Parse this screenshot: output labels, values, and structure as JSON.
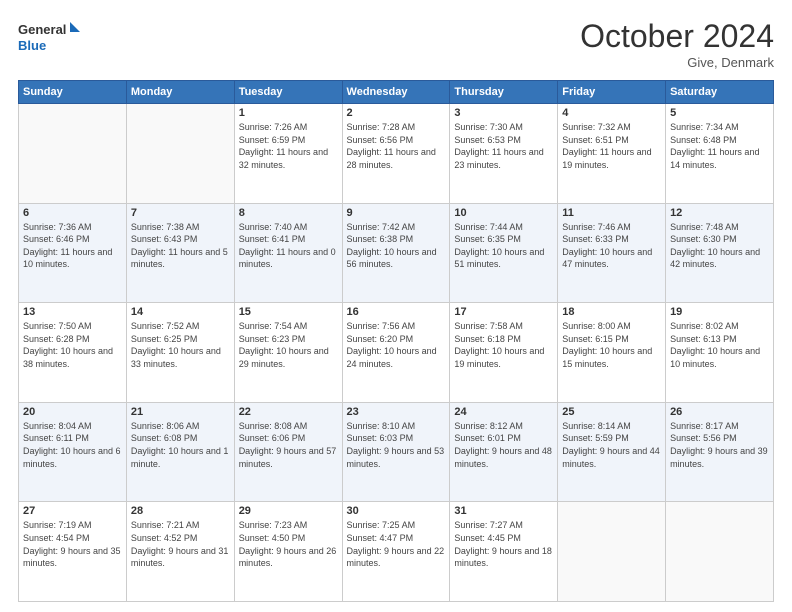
{
  "header": {
    "logo_line1": "General",
    "logo_line2": "Blue",
    "month": "October 2024",
    "location": "Give, Denmark"
  },
  "days_of_week": [
    "Sunday",
    "Monday",
    "Tuesday",
    "Wednesday",
    "Thursday",
    "Friday",
    "Saturday"
  ],
  "weeks": [
    [
      {
        "day": "",
        "detail": ""
      },
      {
        "day": "",
        "detail": ""
      },
      {
        "day": "1",
        "detail": "Sunrise: 7:26 AM\nSunset: 6:59 PM\nDaylight: 11 hours\nand 32 minutes."
      },
      {
        "day": "2",
        "detail": "Sunrise: 7:28 AM\nSunset: 6:56 PM\nDaylight: 11 hours\nand 28 minutes."
      },
      {
        "day": "3",
        "detail": "Sunrise: 7:30 AM\nSunset: 6:53 PM\nDaylight: 11 hours\nand 23 minutes."
      },
      {
        "day": "4",
        "detail": "Sunrise: 7:32 AM\nSunset: 6:51 PM\nDaylight: 11 hours\nand 19 minutes."
      },
      {
        "day": "5",
        "detail": "Sunrise: 7:34 AM\nSunset: 6:48 PM\nDaylight: 11 hours\nand 14 minutes."
      }
    ],
    [
      {
        "day": "6",
        "detail": "Sunrise: 7:36 AM\nSunset: 6:46 PM\nDaylight: 11 hours\nand 10 minutes."
      },
      {
        "day": "7",
        "detail": "Sunrise: 7:38 AM\nSunset: 6:43 PM\nDaylight: 11 hours\nand 5 minutes."
      },
      {
        "day": "8",
        "detail": "Sunrise: 7:40 AM\nSunset: 6:41 PM\nDaylight: 11 hours\nand 0 minutes."
      },
      {
        "day": "9",
        "detail": "Sunrise: 7:42 AM\nSunset: 6:38 PM\nDaylight: 10 hours\nand 56 minutes."
      },
      {
        "day": "10",
        "detail": "Sunrise: 7:44 AM\nSunset: 6:35 PM\nDaylight: 10 hours\nand 51 minutes."
      },
      {
        "day": "11",
        "detail": "Sunrise: 7:46 AM\nSunset: 6:33 PM\nDaylight: 10 hours\nand 47 minutes."
      },
      {
        "day": "12",
        "detail": "Sunrise: 7:48 AM\nSunset: 6:30 PM\nDaylight: 10 hours\nand 42 minutes."
      }
    ],
    [
      {
        "day": "13",
        "detail": "Sunrise: 7:50 AM\nSunset: 6:28 PM\nDaylight: 10 hours\nand 38 minutes."
      },
      {
        "day": "14",
        "detail": "Sunrise: 7:52 AM\nSunset: 6:25 PM\nDaylight: 10 hours\nand 33 minutes."
      },
      {
        "day": "15",
        "detail": "Sunrise: 7:54 AM\nSunset: 6:23 PM\nDaylight: 10 hours\nand 29 minutes."
      },
      {
        "day": "16",
        "detail": "Sunrise: 7:56 AM\nSunset: 6:20 PM\nDaylight: 10 hours\nand 24 minutes."
      },
      {
        "day": "17",
        "detail": "Sunrise: 7:58 AM\nSunset: 6:18 PM\nDaylight: 10 hours\nand 19 minutes."
      },
      {
        "day": "18",
        "detail": "Sunrise: 8:00 AM\nSunset: 6:15 PM\nDaylight: 10 hours\nand 15 minutes."
      },
      {
        "day": "19",
        "detail": "Sunrise: 8:02 AM\nSunset: 6:13 PM\nDaylight: 10 hours\nand 10 minutes."
      }
    ],
    [
      {
        "day": "20",
        "detail": "Sunrise: 8:04 AM\nSunset: 6:11 PM\nDaylight: 10 hours\nand 6 minutes."
      },
      {
        "day": "21",
        "detail": "Sunrise: 8:06 AM\nSunset: 6:08 PM\nDaylight: 10 hours\nand 1 minute."
      },
      {
        "day": "22",
        "detail": "Sunrise: 8:08 AM\nSunset: 6:06 PM\nDaylight: 9 hours\nand 57 minutes."
      },
      {
        "day": "23",
        "detail": "Sunrise: 8:10 AM\nSunset: 6:03 PM\nDaylight: 9 hours\nand 53 minutes."
      },
      {
        "day": "24",
        "detail": "Sunrise: 8:12 AM\nSunset: 6:01 PM\nDaylight: 9 hours\nand 48 minutes."
      },
      {
        "day": "25",
        "detail": "Sunrise: 8:14 AM\nSunset: 5:59 PM\nDaylight: 9 hours\nand 44 minutes."
      },
      {
        "day": "26",
        "detail": "Sunrise: 8:17 AM\nSunset: 5:56 PM\nDaylight: 9 hours\nand 39 minutes."
      }
    ],
    [
      {
        "day": "27",
        "detail": "Sunrise: 7:19 AM\nSunset: 4:54 PM\nDaylight: 9 hours\nand 35 minutes."
      },
      {
        "day": "28",
        "detail": "Sunrise: 7:21 AM\nSunset: 4:52 PM\nDaylight: 9 hours\nand 31 minutes."
      },
      {
        "day": "29",
        "detail": "Sunrise: 7:23 AM\nSunset: 4:50 PM\nDaylight: 9 hours\nand 26 minutes."
      },
      {
        "day": "30",
        "detail": "Sunrise: 7:25 AM\nSunset: 4:47 PM\nDaylight: 9 hours\nand 22 minutes."
      },
      {
        "day": "31",
        "detail": "Sunrise: 7:27 AM\nSunset: 4:45 PM\nDaylight: 9 hours\nand 18 minutes."
      },
      {
        "day": "",
        "detail": ""
      },
      {
        "day": "",
        "detail": ""
      }
    ]
  ]
}
